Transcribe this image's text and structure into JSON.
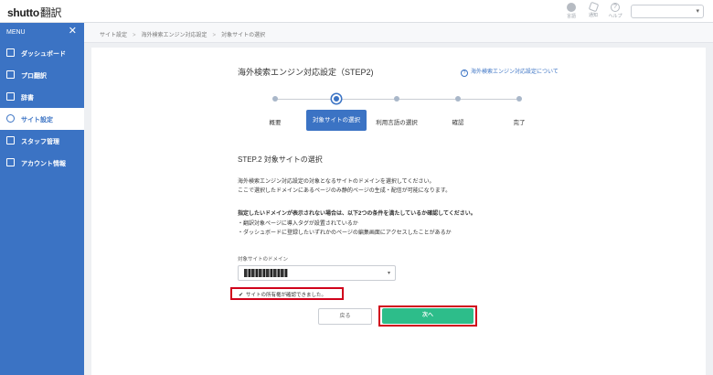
{
  "header": {
    "logo_main": "shutto",
    "logo_sub": "翻訳",
    "icons": [
      {
        "name": "language-icon",
        "label": "言語"
      },
      {
        "name": "notice-icon",
        "label": "通知"
      },
      {
        "name": "help-icon",
        "label": "ヘルプ"
      }
    ],
    "account_select_value": ""
  },
  "sidebar": {
    "menu_label": "MENU",
    "close_symbol": "✕",
    "items": [
      {
        "label": "ダッシュボード",
        "icon": "home-icon"
      },
      {
        "label": "プロ翻訳",
        "icon": "grid-icon"
      },
      {
        "label": "辞書",
        "icon": "book-icon"
      },
      {
        "label": "サイト設定",
        "icon": "gear-icon",
        "active": true
      },
      {
        "label": "スタッフ管理",
        "icon": "staff-icon"
      },
      {
        "label": "アカウント情報",
        "icon": "document-icon"
      }
    ]
  },
  "breadcrumb": [
    "サイト設定",
    "海外検索エンジン対応設定",
    "対象サイトの選択"
  ],
  "main": {
    "title": "海外検索エンジン対応設定（STEP2)",
    "help_link": "海外検索エンジン対応設定について",
    "steps": [
      "概要",
      "対象サイトの選択",
      "利用言語の選択",
      "確認",
      "完了"
    ],
    "active_step": 1,
    "section_title": "STEP.2 対象サイトの選択",
    "desc_line1": "海外検索エンジン対応設定の対象となるサイトのドメインを選択してください。",
    "desc_line2": "ここで選択したドメインにあるページのみ静的ページの生成・配信が可能になります。",
    "note_bold": "指定したいドメインが表示されない場合は、以下2つの条件を満たしているか確認してください。",
    "note_line1": "・翻訳対象ページに導入タグが設置されているか",
    "note_line2": "・ダッシュボードに登録したいずれかのページの編集画面にアクセスしたことがあるか",
    "domain_label": "対象サイトのドメイン",
    "verified_text": "サイトの所有権が確認できました。",
    "back_button": "戻る",
    "next_button": "次へ"
  },
  "colors": {
    "sidebar": "#3b73c4",
    "primary": "#3b73c4",
    "next_button": "#2dbd8a",
    "highlight": "#d0021b"
  }
}
